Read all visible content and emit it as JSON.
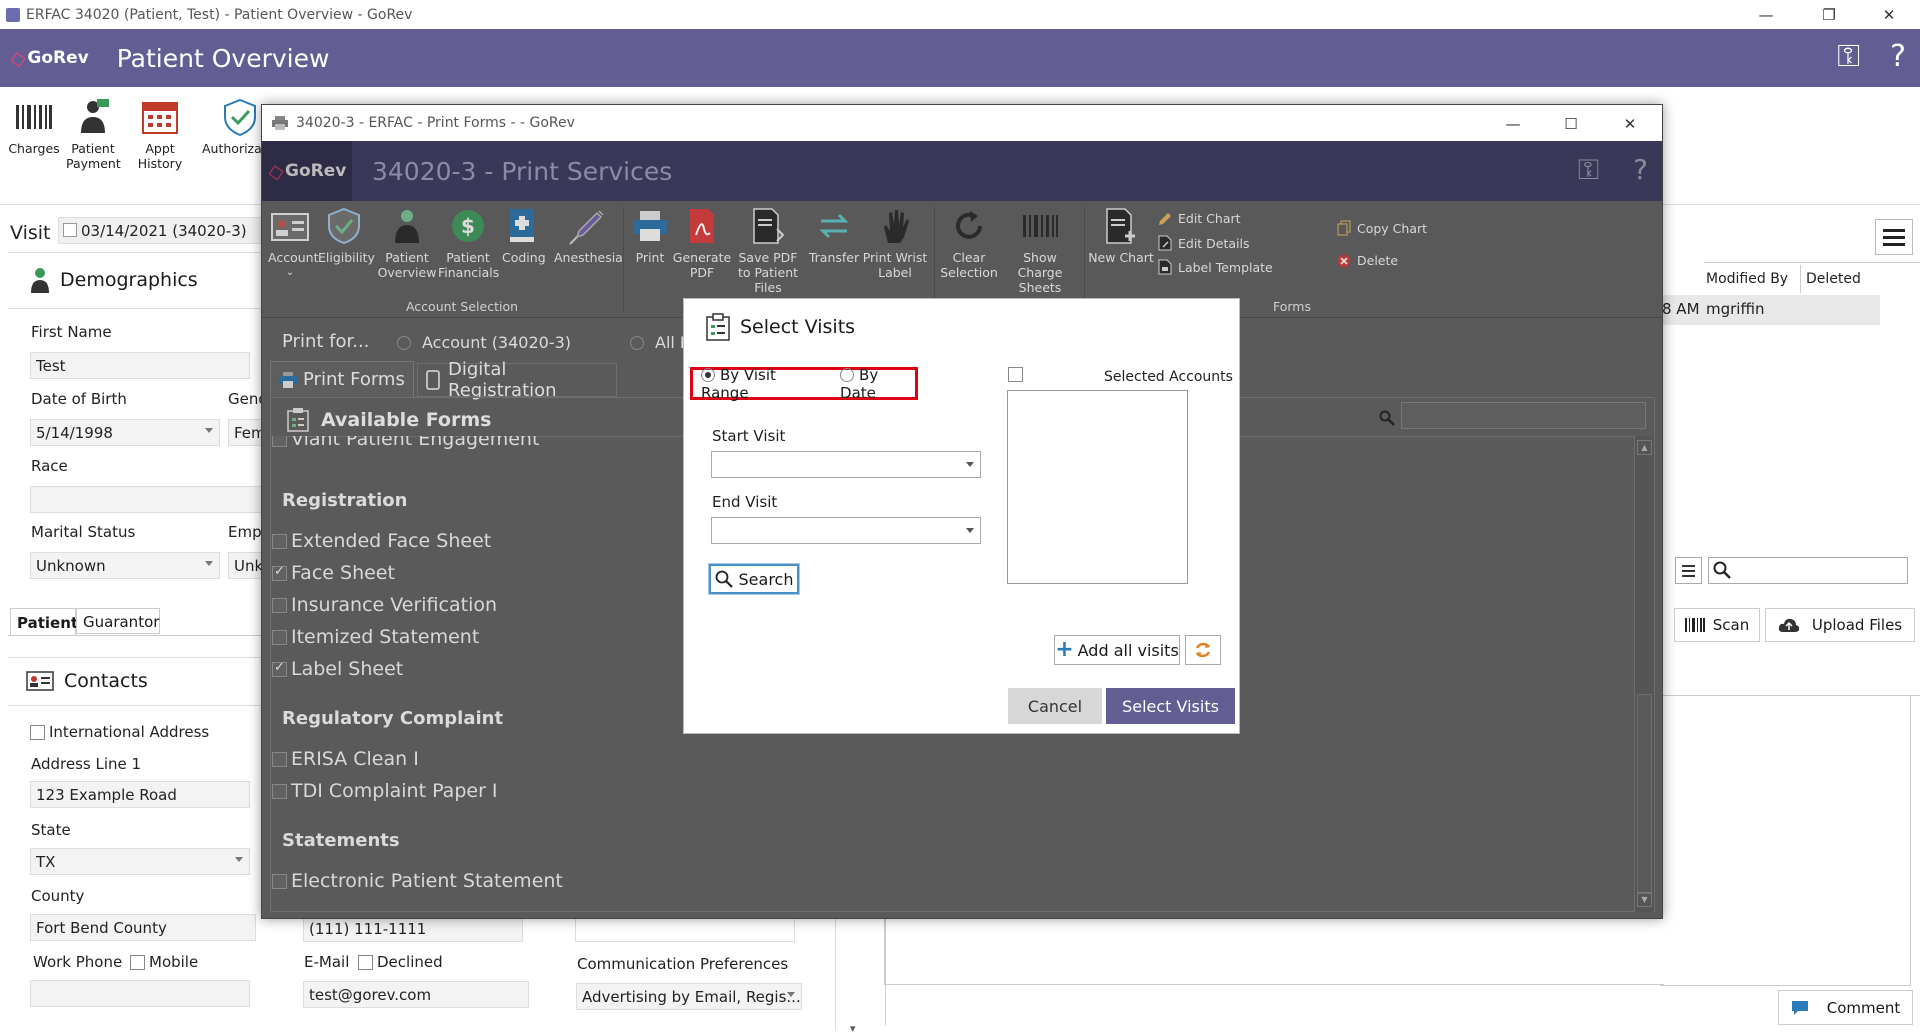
{
  "main_window": {
    "title": "ERFAC 34020 (Patient, Test) - Patient Overview - GoRev",
    "logo": "GoRev",
    "header_title": "Patient Overview",
    "toolbar": [
      {
        "label": "Charges",
        "icon": "barcode-icon"
      },
      {
        "label": "Patient Payment",
        "icon": "patient-payment-icon"
      },
      {
        "label": "Appt History",
        "icon": "calendar-icon"
      },
      {
        "label": "Authorizati",
        "icon": "shield-check-icon"
      }
    ]
  },
  "visit": {
    "label": "Visit",
    "value": "03/14/2021 (34020-3)"
  },
  "demographics": {
    "title": "Demographics",
    "first_name_label": "First Name",
    "first_name": "Test",
    "dob_label": "Date of Birth",
    "dob": "5/14/1998",
    "gender_label": "Gend",
    "gender": "Fem",
    "race_label": "Race",
    "race": "",
    "marital_label": "Marital Status",
    "marital": "Unknown",
    "employment_label": "Empl",
    "employment": "Unk",
    "tabs": [
      "Patient",
      "Guarantor"
    ]
  },
  "contacts": {
    "title": "Contacts",
    "intl_address": "International Address",
    "address1_label": "Address Line 1",
    "address1": "123 Example Road",
    "state_label": "State",
    "state": "TX",
    "county_label": "County",
    "county": "Fort Bend County",
    "work_phone_label": "Work Phone",
    "mobile_label": "Mobile",
    "phone": "(111) 111-1111",
    "email_label": "E-Mail",
    "declined_label": "Declined",
    "email": "test@gorev.com",
    "comm_label": "Communication Preferences",
    "comm_value": "Advertising by Email, Regis..."
  },
  "right_panel": {
    "col_modified": "Modified By",
    "col_deleted": "Deleted",
    "row_time": "8 AM",
    "row_user": "mgriffin",
    "scan": "Scan",
    "upload": "Upload Files",
    "comment": "Comment"
  },
  "print_window": {
    "title": "34020-3 - ERFAC - Print Forms -  - GoRev",
    "logo": "GoRev",
    "header_title": "34020-3 - Print Services",
    "toolbar": [
      {
        "label": "Account",
        "icon": "account-card-icon"
      },
      {
        "label": "Eligibility",
        "icon": "eligibility-icon"
      },
      {
        "label": "Patient Overview",
        "icon": "patient-overview-icon"
      },
      {
        "label": "Patient Financials",
        "icon": "dollar-icon"
      },
      {
        "label": "Coding",
        "icon": "coding-book-icon"
      },
      {
        "label": "Anesthesia",
        "icon": "syringe-icon"
      },
      {
        "label": "Print",
        "icon": "printer-icon"
      },
      {
        "label": "Generate PDF",
        "icon": "pdf-icon"
      },
      {
        "label": "Save PDF to Patient Files",
        "icon": "save-pdf-icon"
      },
      {
        "label": "Transfer",
        "icon": "transfer-icon"
      },
      {
        "label": "Print Wrist Label",
        "icon": "hand-icon"
      },
      {
        "label": "Clear Selection",
        "icon": "refresh-icon"
      },
      {
        "label": "Show Charge Sheets",
        "icon": "barcode-icon"
      },
      {
        "label": "New Chart",
        "icon": "new-chart-icon"
      }
    ],
    "small_actions": [
      "Edit Chart",
      "Edit Details",
      "Label Template",
      "Copy Chart",
      "Delete"
    ],
    "group_account": "Account Selection",
    "group_forms": "Forms",
    "print_for": "Print for...",
    "account_option": "Account (34020-3)",
    "all_option": "All P",
    "tabs": [
      "Print Forms",
      "Digital Registration"
    ],
    "available_forms": "Available Forms",
    "partial_item": "Viant Patient Engagement",
    "sections": [
      {
        "title": "Registration",
        "items": [
          {
            "label": "Extended Face Sheet",
            "checked": false
          },
          {
            "label": "Face Sheet",
            "checked": true
          },
          {
            "label": "Insurance Verification",
            "checked": false
          },
          {
            "label": "Itemized Statement",
            "checked": false
          },
          {
            "label": "Label Sheet",
            "checked": true
          }
        ]
      },
      {
        "title": "Regulatory Complaint",
        "items": [
          {
            "label": "ERISA Clean I",
            "checked": false
          },
          {
            "label": "TDI Complaint Paper I",
            "checked": false
          }
        ]
      },
      {
        "title": "Statements",
        "items": [
          {
            "label": "Electronic Patient Statement",
            "checked": false
          }
        ]
      }
    ]
  },
  "dialog": {
    "title": "Select Visits",
    "by_visit_range": "By Visit Range",
    "by_date": "By Date",
    "start_visit": "Start Visit",
    "end_visit": "End Visit",
    "search": "Search",
    "selected_accounts": "Selected Accounts",
    "add_all_visits": "Add all visits",
    "cancel": "Cancel",
    "select_visits": "Select Visits"
  },
  "colors": {
    "brand_header": "#625e94",
    "dialog_primary": "#625e94",
    "highlight": "#e00015"
  }
}
